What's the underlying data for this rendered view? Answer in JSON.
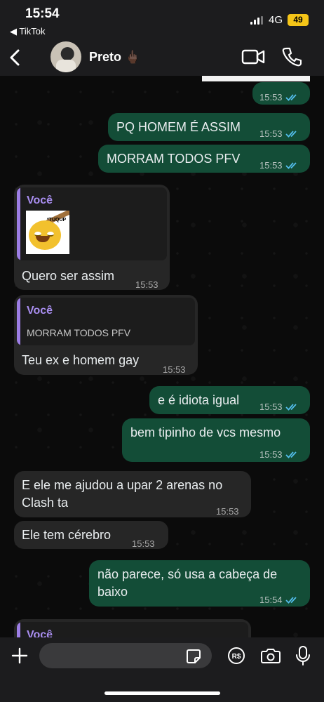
{
  "status_bar": {
    "time": "15:54",
    "back_app": "◀ TikTok",
    "network": "4G",
    "battery": "49"
  },
  "header": {
    "contact_name": "Preto 🖕🏿",
    "icons": {
      "back": "chevron-left-icon",
      "video": "video-camera-icon",
      "call": "phone-icon"
    }
  },
  "messages": [
    {
      "dir": "out",
      "text": "",
      "time": "15:53"
    },
    {
      "dir": "out",
      "text": "PQ HOMEM É ASSIM",
      "time": "15:53"
    },
    {
      "dir": "out",
      "text": "MORRAM TODOS PFV",
      "time": "15:53"
    },
    {
      "dir": "in",
      "quote_author": "Você",
      "quote_sticker_caption": "*TUQUP",
      "text": "Quero ser assim",
      "time": "15:53"
    },
    {
      "dir": "in",
      "quote_author": "Você",
      "quote_text": "MORRAM TODOS PFV",
      "text": "Teu ex e homem gay",
      "time": "15:53"
    },
    {
      "dir": "out",
      "text": "e é idiota igual",
      "time": "15:53"
    },
    {
      "dir": "out",
      "text": "bem tipinho de vcs mesmo",
      "time": "15:53"
    },
    {
      "dir": "in",
      "lines": [
        "E ele me ajudou a upar 2 arenas no",
        "Clash ta"
      ],
      "time": "15:53"
    },
    {
      "dir": "in",
      "text": "Ele tem cérebro",
      "time": "15:53"
    },
    {
      "dir": "out",
      "lines": [
        "não parece, só usa a cabeça de",
        "baixo"
      ],
      "time": "15:54"
    },
    {
      "dir": "in",
      "quote_author": "Você"
    }
  ],
  "input_bar": {
    "placeholder": "",
    "icons": [
      "plus-icon",
      "sticker-icon",
      "pix-icon",
      "camera-icon",
      "microphone-icon"
    ]
  },
  "colors": {
    "outgoing_bubble": "#134d37",
    "incoming_bubble": "#262626",
    "read_ticks": "#53bdeb",
    "quote_accent": "#9d7ee6",
    "battery": "#f5c518"
  }
}
